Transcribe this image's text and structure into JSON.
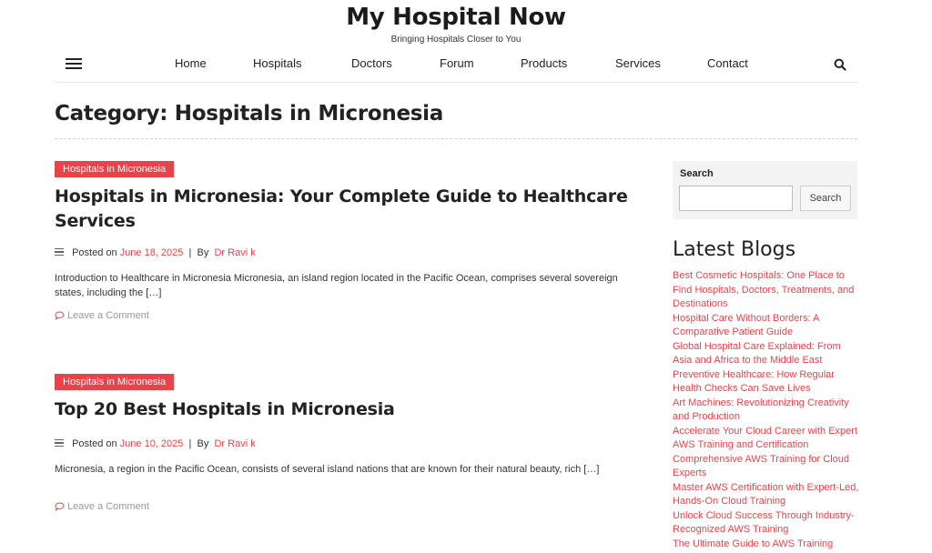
{
  "site": {
    "title": "My Hospital Now",
    "tagline": "Bringing Hospitals Closer to You"
  },
  "nav": {
    "items": [
      "Home",
      "Hospitals",
      "Doctors",
      "Forum",
      "Products",
      "Services",
      "Contact"
    ]
  },
  "category": {
    "heading": "Category: Hospitals in Micronesia"
  },
  "posts": [
    {
      "badge": "Hospitals in Micronesia",
      "title": "Hospitals in Micronesia: Your Complete Guide to Healthcare Services",
      "posted_on_label": "Posted on",
      "date": "June 18, 2025",
      "separator": "|",
      "by_label": "By",
      "author": "Dr Ravi k",
      "excerpt": "Introduction to Healthcare in Micronesia Micronesia, an island region located in the Pacific Ocean, comprises several sovereign states, including the […]",
      "comment_link": "Leave a Comment"
    },
    {
      "badge": "Hospitals in Micronesia",
      "title": "Top 20 Best Hospitals in Micronesia",
      "posted_on_label": "Posted on",
      "date": "June 10, 2025",
      "separator": "|",
      "by_label": "By",
      "author": "Dr Ravi k",
      "excerpt": "Micronesia, a region in the Pacific Ocean, consists of several island nations that are known for their natural beauty, rich […]",
      "comment_link": "Leave a Comment"
    }
  ],
  "sidebar": {
    "search_label": "Search",
    "search_value": "",
    "search_button": "Search",
    "latest_title": "Latest Blogs",
    "latest_items": [
      "Best Cosmetic Hospitals: One Place to Find Hospitals, Doctors, Treatments, and Destinations",
      "Hospital Care Without Borders: A Comparative Patient Guide",
      "Global Hospital Care Explained: From Asia and Africa to the Middle East",
      "Preventive Healthcare: How Regular Health Checks Can Save Lives",
      "Art Machines: Revolutionizing Creativity and Production",
      "Accelerate Your Cloud Career with Expert AWS Training and Certification",
      "Comprehensive AWS Training for Cloud Experts",
      "Master AWS Certification with Expert-Led, Hands-On Cloud Training",
      "Unlock Cloud Success Through Industry-Recognized AWS Training",
      "The Ultimate Guide to AWS Training"
    ]
  },
  "colors": {
    "accent": "#e8434a",
    "text": "#222222",
    "muted": "#999999"
  },
  "icons": [
    "hamburger-menu-icon",
    "search-icon",
    "lines-icon",
    "comment-icon"
  ]
}
